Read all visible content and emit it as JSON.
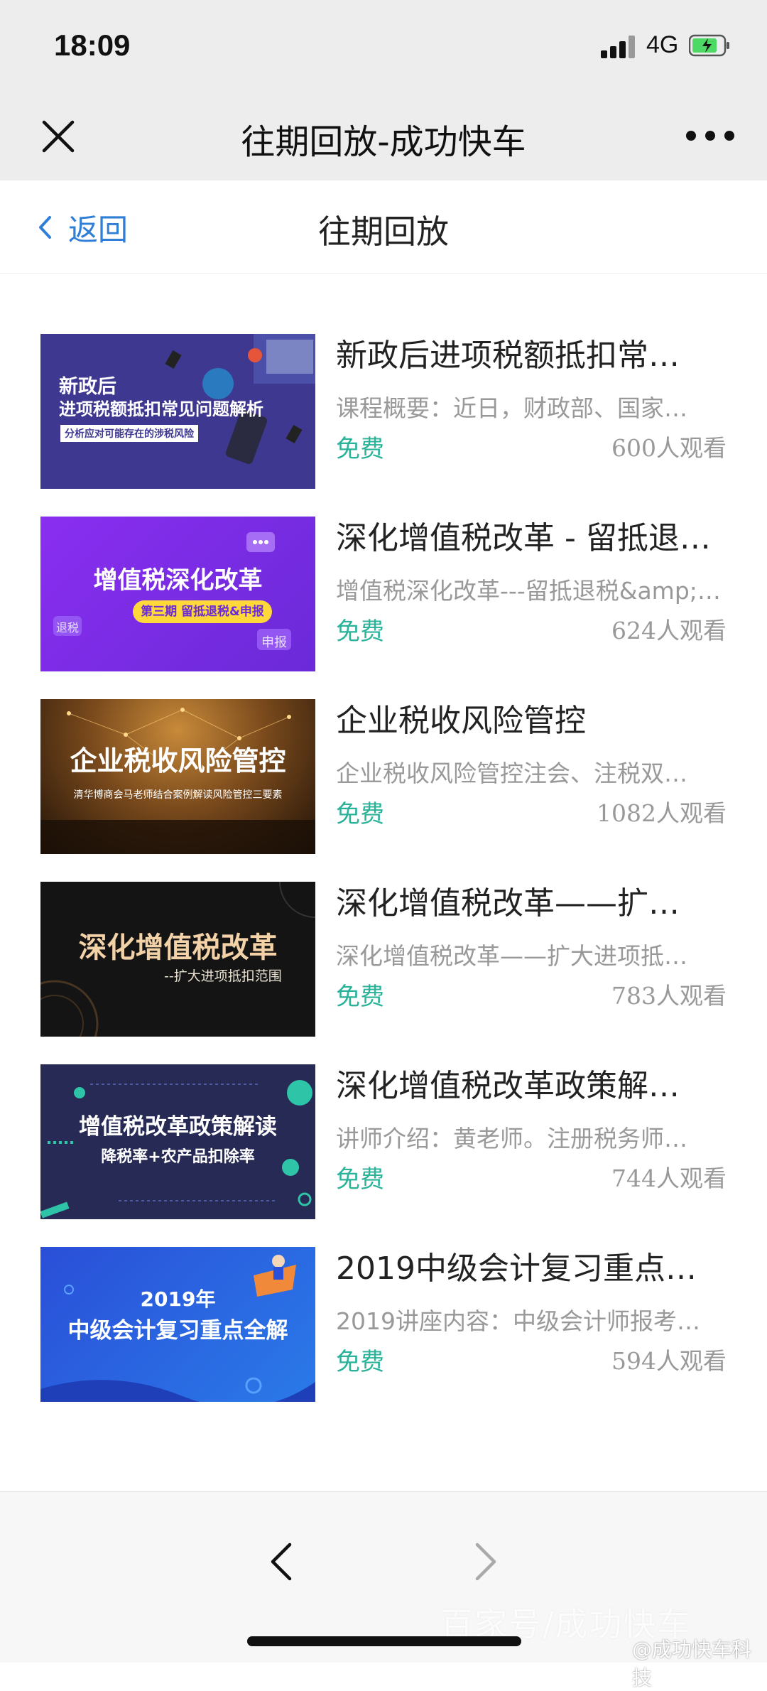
{
  "status_bar": {
    "time": "18:09",
    "network": "4G",
    "battery_color": "#4cd964"
  },
  "nav": {
    "title": "往期回放-成功快车"
  },
  "subheader": {
    "back_label": "返回",
    "title": "往期回放"
  },
  "items": [
    {
      "title": "新政后进项税额抵扣常…",
      "desc": "课程概要：近日，财政部、国家…",
      "price": "免费",
      "views": "600人观看",
      "thumb": {
        "line1": "新政后",
        "line2": "进项税额抵扣常见问题解析",
        "line3": "分析应对可能存在的涉税风险",
        "bg": "#3e3891"
      }
    },
    {
      "title": "深化增值税改革 - 留抵退…",
      "desc": "增值税深化改革---留抵退税&amp;…",
      "price": "免费",
      "views": "624人观看",
      "thumb": {
        "line1": "增值税深化改革",
        "line2": "第三期  留抵退税&申报",
        "tag1": "退税",
        "tag2": "申报",
        "bg": "#7b2ee6"
      }
    },
    {
      "title": "企业税收风险管控",
      "desc": "企业税收风险管控注会、注税双…",
      "price": "免费",
      "views": "1082人观看",
      "thumb": {
        "line1": "企业税收风险管控",
        "line2": "清华博商会马老师结合案例解读风险管控三要素",
        "bg": "#5a3a1a"
      }
    },
    {
      "title": "深化增值税改革——扩…",
      "desc": "深化增值税改革——扩大进项抵…",
      "price": "免费",
      "views": "783人观看",
      "thumb": {
        "line1": "深化增值税改革",
        "line2": "--扩大进项抵扣范围",
        "bg": "#141414"
      }
    },
    {
      "title": "深化增值税改革政策解…",
      "desc": "讲师介绍：黄老师。注册税务师…",
      "price": "免费",
      "views": "744人观看",
      "thumb": {
        "line1": "增值税改革政策解读",
        "line2": "降税率+农产品扣除率",
        "bg": "#262a55"
      }
    },
    {
      "title": "2019中级会计复习重点…",
      "desc": "2019讲座内容：中级会计师报考…",
      "price": "免费",
      "views": "594人观看",
      "thumb": {
        "line1": "2019年",
        "line2": "中级会计复习重点全解",
        "bg": "#2a4fd8"
      }
    }
  ],
  "watermark": {
    "main": "百家号/成功快车",
    "sub": "@成功快车科技"
  }
}
